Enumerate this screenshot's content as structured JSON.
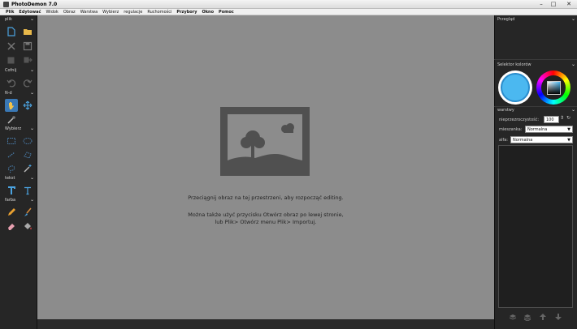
{
  "window": {
    "title": "PhotoDemon 7.0"
  },
  "menu": [
    {
      "label": "Plik",
      "bold": true
    },
    {
      "label": "Edytować",
      "bold": true
    },
    {
      "label": "Widok",
      "bold": false
    },
    {
      "label": "Obraz",
      "bold": false
    },
    {
      "label": "Warstwa",
      "bold": false
    },
    {
      "label": "Wybierz",
      "bold": false
    },
    {
      "label": "regulacje",
      "bold": false
    },
    {
      "label": "Ruchomości",
      "bold": false
    },
    {
      "label": "Przybory",
      "bold": true
    },
    {
      "label": "Okno",
      "bold": true
    },
    {
      "label": "Pomoc",
      "bold": true
    }
  ],
  "toolbox": {
    "sections": [
      {
        "key": "file",
        "label": "plik"
      },
      {
        "key": "undo",
        "label": "Cofnij"
      },
      {
        "key": "nav",
        "label": "N-d"
      },
      {
        "key": "select",
        "label": "Wybierz"
      },
      {
        "key": "text",
        "label": "tekst"
      },
      {
        "key": "paint",
        "label": "farba"
      }
    ]
  },
  "canvas": {
    "line1": "Przeciągnij obraz na tej przestrzeni, aby rozpocząć editing.",
    "line2": "Można także użyć przycisku Otwórz obraz po lewej stronie,",
    "line3": "lub Plik> Otwórz menu Plik> Importuj."
  },
  "panels": {
    "overview_title": "Przegląd",
    "color_selector_title": "Selektor kolorów",
    "primary_color": "#4bb8f0",
    "layers_title": "warstwy",
    "opacity_label": "nieprzezroczystość:",
    "opacity_value": "100",
    "blend_label": "mieszanka:",
    "blend_value": "Normalna",
    "alpha_label": "alfa:",
    "alpha_value": "Normalna"
  }
}
